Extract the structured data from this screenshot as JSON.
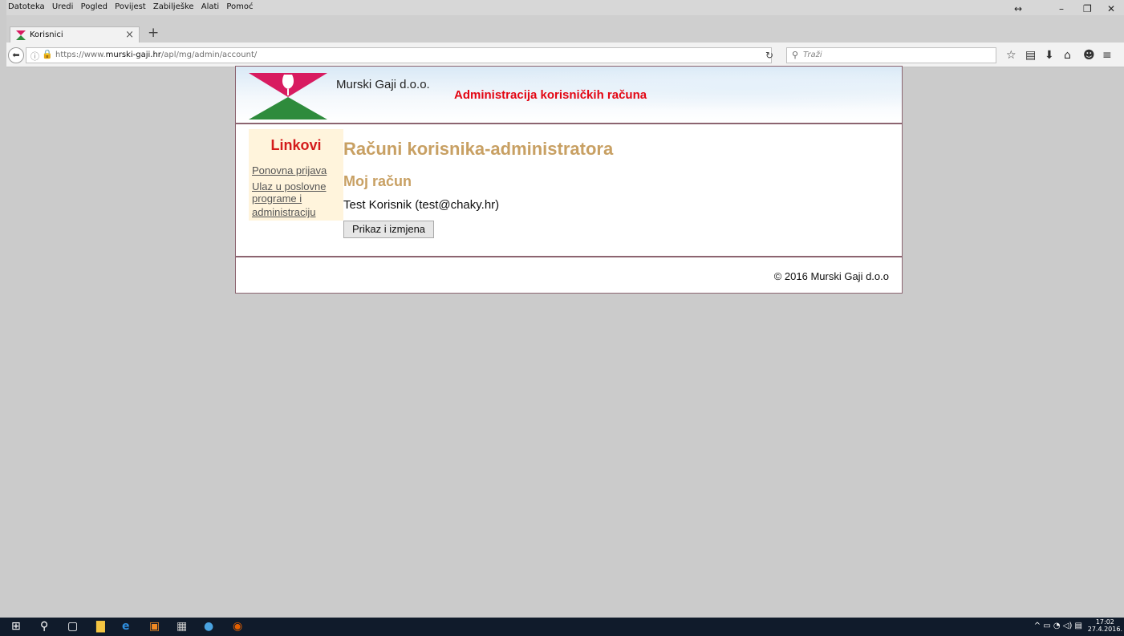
{
  "browser": {
    "menu": [
      "Datoteka",
      "Uredi",
      "Pogled",
      "Povijest",
      "Zabilješke",
      "Alati",
      "Pomoć"
    ],
    "tab_title": "Korisnici",
    "url_prefix": "https://www.",
    "url_domain": "murski-gaji.hr",
    "url_path": "/apl/mg/admin/account/",
    "search_placeholder": "Traži"
  },
  "header": {
    "company": "Murski Gaji d.o.o.",
    "title": "Administracija korisničkih računa"
  },
  "sidebar": {
    "title": "Linkovi",
    "links": [
      {
        "label": "Ponovna prijava"
      },
      {
        "label": "Ulaz u poslovne"
      },
      {
        "label": "programe i"
      },
      {
        "label": "administraciju"
      }
    ]
  },
  "main": {
    "heading": "Računi korisnika-administratora",
    "subheading": "Moj račun",
    "user": "Test Korisnik (test@chaky.hr)",
    "button": "Prikaz i izmjena"
  },
  "footer": {
    "copyright": "© 2016 Murski Gaji d.o.o"
  },
  "taskbar": {
    "time": "17:02",
    "date": "27.4.2016."
  },
  "colors": {
    "accent": "#c8a063",
    "brand_red": "#e30613",
    "border": "#8c6470",
    "sidebar_bg": "#fff4dc"
  }
}
